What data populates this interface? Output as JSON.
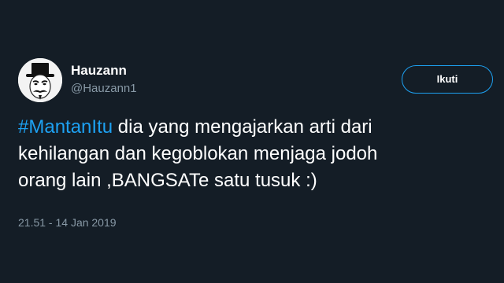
{
  "author": {
    "display_name": "Hauzann",
    "handle": "@Hauzann1",
    "avatar_icon": "masked-face-with-top-hat-icon"
  },
  "follow_button": {
    "label": "Ikuti"
  },
  "tweet": {
    "hashtag": "#MantanItu",
    "line1_rest": " dia yang mengajarkan arti dari",
    "line2": "kehilangan dan kegoblokan menjaga jodoh",
    "line3": "orang lain ,BANGSATe satu tusuk :)"
  },
  "timestamp": "21.51 - 14 Jan 2019",
  "colors": {
    "background": "#141d26",
    "accent": "#1da1f2",
    "muted": "#8899a6",
    "text": "#ffffff"
  }
}
